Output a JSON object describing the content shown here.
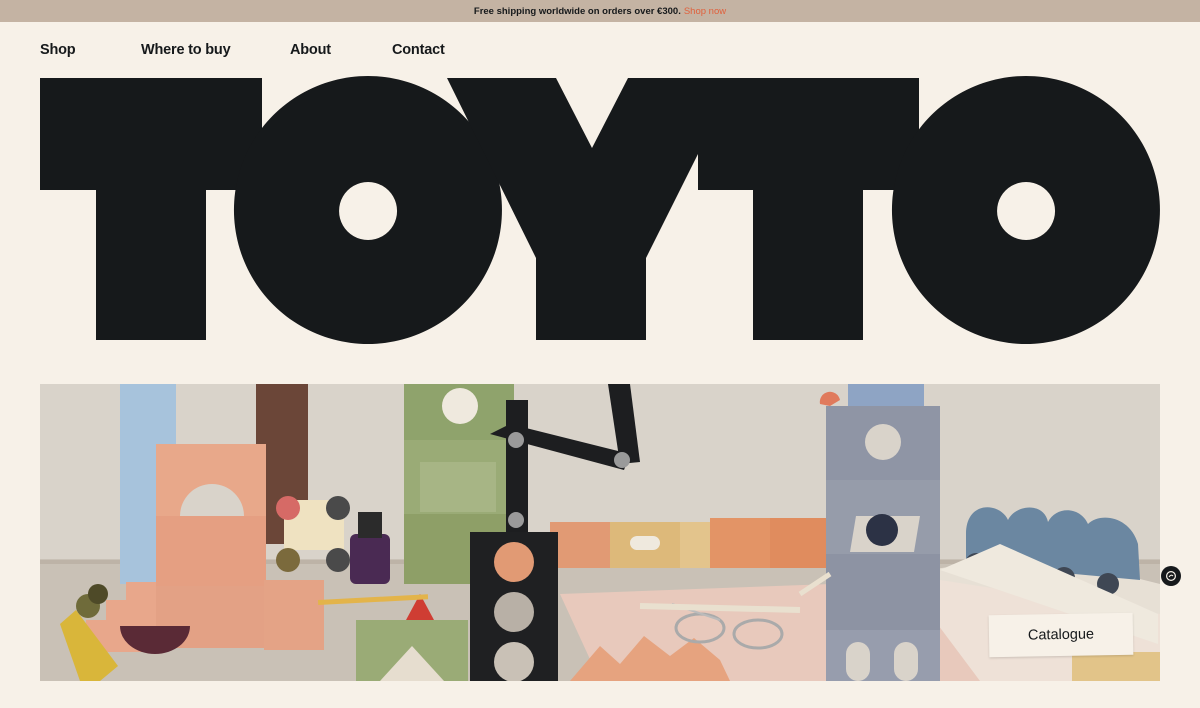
{
  "announcement": {
    "text": "Free shipping worldwide on orders over €300.",
    "link_label": "Shop now"
  },
  "nav": {
    "items": [
      {
        "label": "Shop"
      },
      {
        "label": "Where to buy"
      },
      {
        "label": "About"
      },
      {
        "label": "Contact"
      }
    ]
  },
  "brand": {
    "logo_text": "TOYTO",
    "logo_color": "#16191b"
  },
  "hero": {
    "image_subject": "wooden toy blocks and rulers on a desk",
    "cta_label": "Catalogue"
  },
  "floating_badge": {
    "icon": "hand-wave-icon"
  },
  "colors": {
    "background": "#f7f1e8",
    "announcement_bar": "#c4b3a3",
    "accent": "#e0603c",
    "text": "#16191b"
  }
}
